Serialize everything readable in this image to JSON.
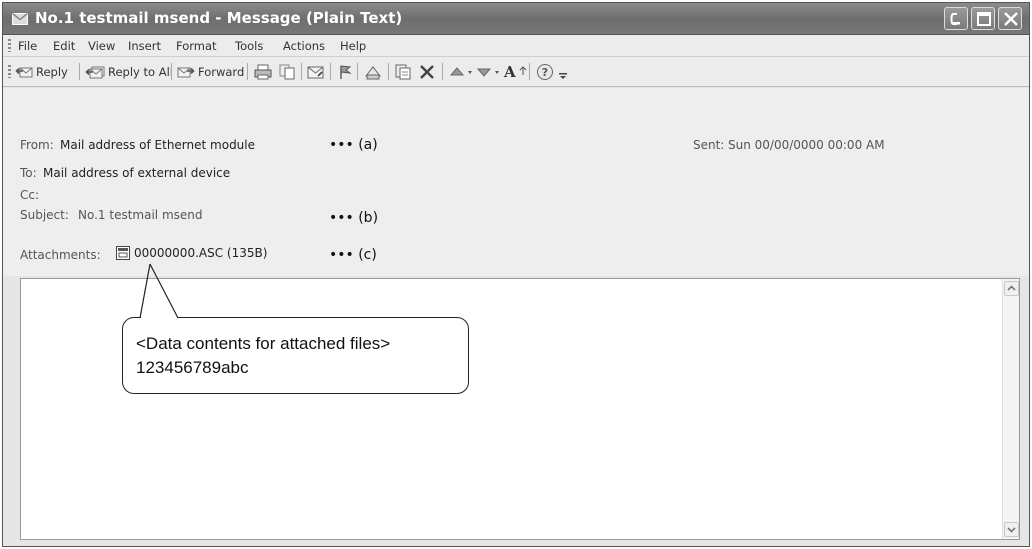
{
  "window": {
    "title": "No.1 testmail msend - Message (Plain Text)"
  },
  "menu": [
    {
      "label": "File"
    },
    {
      "label": "Edit"
    },
    {
      "label": "View"
    },
    {
      "label": "Insert"
    },
    {
      "label": "Format"
    },
    {
      "label": "Tools"
    },
    {
      "label": "Actions"
    },
    {
      "label": "Help"
    }
  ],
  "toolbar": {
    "reply": "Reply",
    "reply_all": "Reply to All",
    "forward": "Forward",
    "font_size": "A"
  },
  "header": {
    "from_label": "From:",
    "from_value": "Mail address of Ethernet module",
    "to_label": "To:",
    "to_value": "Mail address of external device",
    "cc_label": "Cc:",
    "subject_label": "Subject:",
    "subject_value": "No.1 testmail msend",
    "attachments_label": "Attachments:",
    "attachment_name": "00000000.ASC (135B)",
    "sent_label": "Sent:",
    "sent_value": "Sun 00/00/0000 00:00 AM"
  },
  "annotations": {
    "a": "••• (a)",
    "b": "••• (b)",
    "c": "••• (c)"
  },
  "callout": {
    "line1": "<Data contents for attached files>",
    "line2": "123456789abc"
  }
}
